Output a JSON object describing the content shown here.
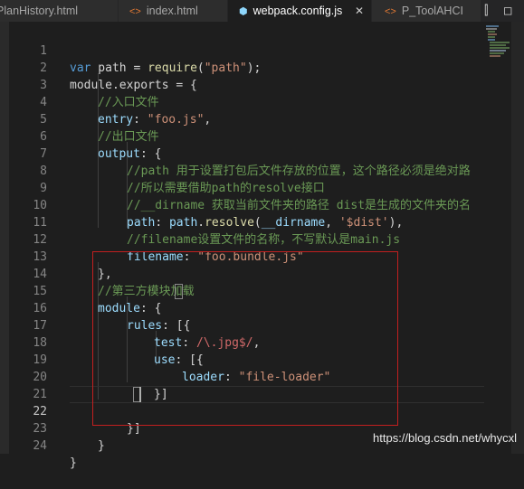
{
  "tabs": [
    {
      "label": "PlanHistory.html",
      "icon": "html-icon"
    },
    {
      "label": "index.html",
      "icon": "html-icon"
    },
    {
      "label": "webpack.config.js",
      "icon": "webpack-icon",
      "active": true
    },
    {
      "label": "P_ToolAHCI",
      "icon": "html-icon"
    }
  ],
  "tab_actions": {
    "split": "split-editor-icon",
    "layout": "layout-icon"
  },
  "active_line": 22,
  "lines": [
    {
      "n": "1"
    },
    {
      "n": "2"
    },
    {
      "n": "3"
    },
    {
      "n": "4"
    },
    {
      "n": "5"
    },
    {
      "n": "6"
    },
    {
      "n": "7"
    },
    {
      "n": "8"
    },
    {
      "n": "9"
    },
    {
      "n": "10"
    },
    {
      "n": "11"
    },
    {
      "n": "12"
    },
    {
      "n": "13"
    },
    {
      "n": "14"
    },
    {
      "n": "15"
    },
    {
      "n": "16"
    },
    {
      "n": "17"
    },
    {
      "n": "18"
    },
    {
      "n": "19"
    },
    {
      "n": "20"
    },
    {
      "n": "21"
    },
    {
      "n": "22"
    },
    {
      "n": "23"
    },
    {
      "n": "24"
    }
  ],
  "code": {
    "l1": {
      "kw": "var",
      "ident": " path = ",
      "fn": "require",
      "open": "(",
      "str": "\"path\"",
      "close": ");"
    },
    "l2": {
      "text": "module.exports = {"
    },
    "l3": {
      "cmt": "//入口文件"
    },
    "l4": {
      "prop": "entry",
      "colon": ": ",
      "str": "\"foo.js\"",
      "end": ","
    },
    "l5": {
      "cmt": "//出口文件"
    },
    "l6": {
      "prop": "output",
      "rest": ": {"
    },
    "l7": {
      "cmt": "//path 用于设置打包后文件存放的位置，这个路径必须是绝对路"
    },
    "l8": {
      "cmt": "//所以需要借助path的resolve接口"
    },
    "l9": {
      "cmt": "//__dirname 获取当前文件夹的路径 dist是生成的文件夹的名"
    },
    "l10": {
      "prop": "path",
      "colon": ": ",
      "obj": "path",
      "dot": ".",
      "fn": "resolve",
      "open": "(",
      "arg": "__dirname",
      "comma": ", ",
      "str": "'$dist'",
      "close": "),"
    },
    "l11": {
      "cmt": "//filename设置文件的名称，不写默认是main.js"
    },
    "l12": {
      "prop": "filename",
      "colon": ": ",
      "str": "\"foo.bundle.js\""
    },
    "l13": {
      "text": "},"
    },
    "l14": {
      "cmt": "//第三方模块加载"
    },
    "l15": {
      "prop": "module",
      "rest": ": {"
    },
    "l16": {
      "prop": "rules",
      "colon": ": ",
      "rest": "[{"
    },
    "l17": {
      "prop": "test",
      "colon": ": ",
      "re": "/\\.jpg$/",
      "end": ","
    },
    "l18": {
      "prop": "use",
      "colon": ": ",
      "rest": "[{"
    },
    "l19": {
      "prop": "loader",
      "colon": ": ",
      "str": "\"file-loader\""
    },
    "l20": {
      "text": "}]"
    },
    "l21": {
      "text": ""
    },
    "l22": {
      "text": "}]"
    },
    "l23": {
      "text": "}"
    },
    "l24": {
      "text": "}"
    }
  },
  "watermark": "https://blog.csdn.net/whycxl",
  "colors": {
    "keyword": "#569cd6",
    "string": "#ce9178",
    "comment": "#6a9955",
    "property": "#9cdcfe",
    "function": "#dcdcaa",
    "regex": "#d16969",
    "highlight_box": "#c21f1f"
  }
}
